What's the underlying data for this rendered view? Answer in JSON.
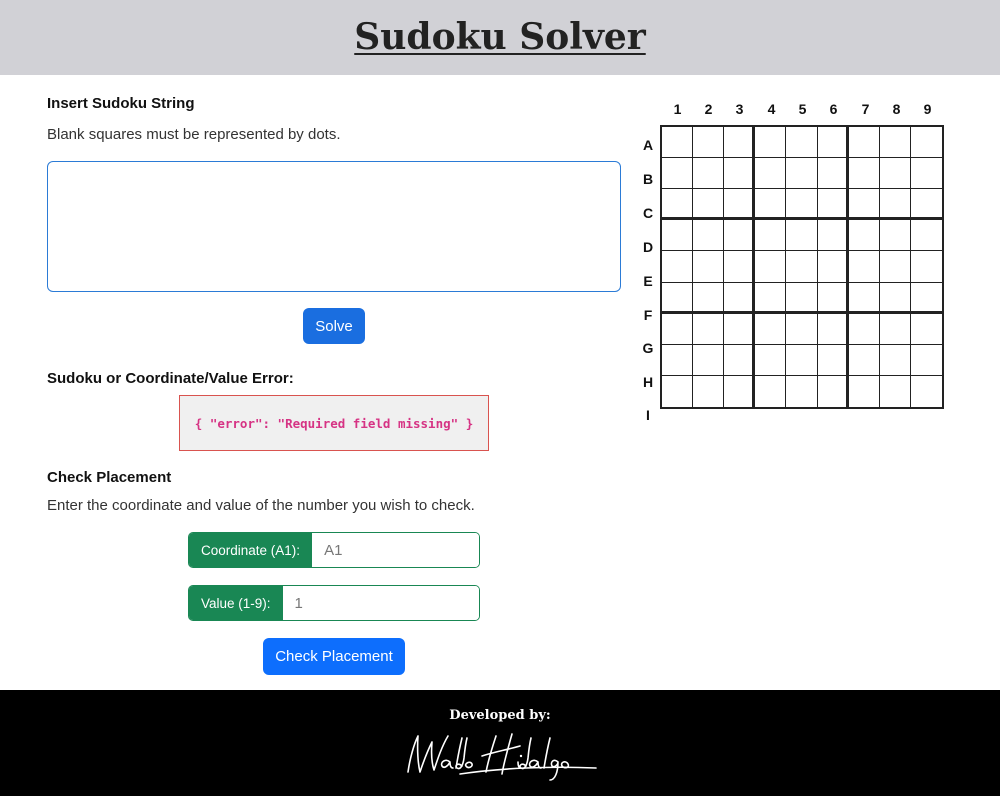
{
  "header": {
    "title": "Sudoku Solver"
  },
  "insert": {
    "heading": "Insert Sudoku String",
    "helper": "Blank squares must be represented by dots.",
    "textarea_value": "",
    "solve_label": "Solve"
  },
  "error": {
    "heading": "Sudoku or Coordinate/Value Error:",
    "message": "{ \"error\": \"Required field missing\" }"
  },
  "check": {
    "heading": "Check Placement",
    "helper": "Enter the coordinate and value of the number you wish to check.",
    "coordinate_label": "Coordinate (A1):",
    "coordinate_placeholder": "A1",
    "value_label": "Value (1-9):",
    "value_placeholder": "1",
    "button_label": "Check Placement"
  },
  "grid": {
    "columns": [
      "1",
      "2",
      "3",
      "4",
      "5",
      "6",
      "7",
      "8",
      "9"
    ],
    "rows": [
      "A",
      "B",
      "C",
      "D",
      "E",
      "F",
      "G",
      "H",
      "I"
    ]
  },
  "footer": {
    "label": "Developed by:",
    "signature": "Waldo Hidalgo"
  },
  "colors": {
    "header_bg": "#d1d1d6",
    "primary_button": "#0d6efd",
    "success_label": "#198754",
    "error_border": "#d9534f",
    "error_text": "#d63384",
    "footer_bg": "#000000"
  }
}
